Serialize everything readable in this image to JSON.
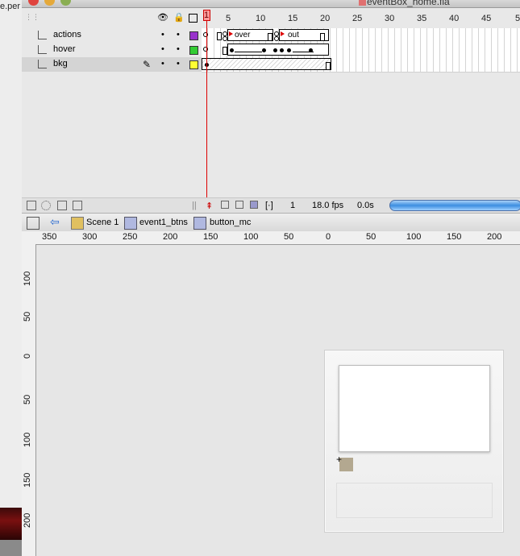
{
  "window": {
    "title": "eventBox_home.fla",
    "left_window_text": "e.per"
  },
  "timeline": {
    "frame_numbers": [
      "1",
      "5",
      "10",
      "15",
      "20",
      "25",
      "30",
      "35",
      "40",
      "45",
      "5"
    ],
    "header_icons": [
      "eye-icon",
      "lock-icon",
      "outline-icon"
    ],
    "layers": [
      {
        "name": "actions",
        "color": "#9933cc",
        "selected": false
      },
      {
        "name": "hover",
        "color": "#33cc33",
        "selected": false
      },
      {
        "name": "bkg",
        "color": "#ffff33",
        "selected": true
      }
    ],
    "frame_labels": [
      "over",
      "out"
    ],
    "status": {
      "current_frame": "1",
      "fps": "18.0 fps",
      "elapsed": "0.0s"
    }
  },
  "editbar": {
    "breadcrumbs": [
      "Scene 1",
      "event1_btns",
      "button_mc"
    ]
  },
  "rulers": {
    "horizontal": [
      "350",
      "300",
      "250",
      "200",
      "150",
      "100",
      "50",
      "0",
      "50",
      "100",
      "150",
      "200"
    ],
    "vertical": [
      "100",
      "50",
      "0",
      "50",
      "100",
      "150",
      "200"
    ]
  },
  "stage": {
    "swatch_color": "#b3a890"
  }
}
